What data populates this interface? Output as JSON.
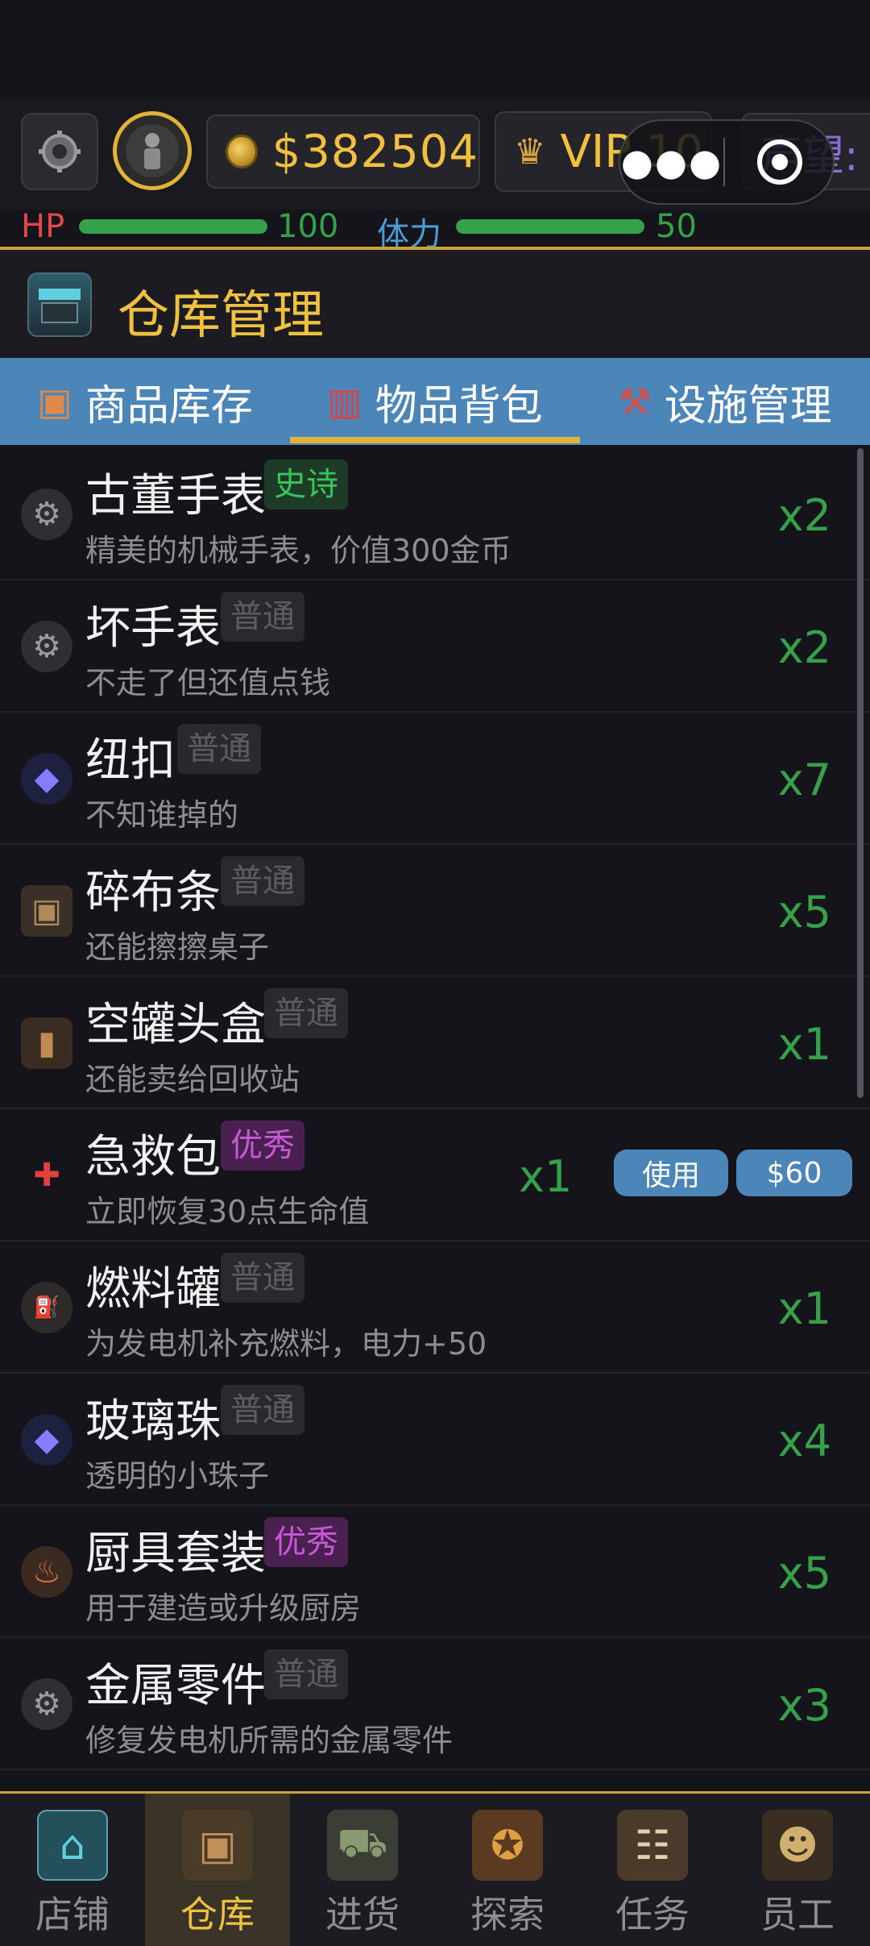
{
  "colors": {
    "accent_gold": "#f0c040",
    "tab_blue": "#4c86b8",
    "qty_green": "#35a14a",
    "hp_red": "#e04848",
    "stamina_blue": "#4c9ad6",
    "rep_purple": "#8b6fd6"
  },
  "top": {
    "money": "$382504",
    "vip": "VIP 10",
    "reputation": "声望:"
  },
  "stats": {
    "hp_label": "HP",
    "hp_value": "100",
    "hp_fill": 1.0,
    "stamina_label": "体力",
    "stamina_value": "50",
    "stamina_fill": 1.0
  },
  "header": {
    "title": "仓库管理",
    "icon": "shop-sign-icon"
  },
  "tabs": [
    {
      "label": "商品库存",
      "icon": "box-icon"
    },
    {
      "label": "物品背包",
      "icon": "backpack-icon"
    },
    {
      "label": "设施管理",
      "icon": "crane-icon"
    }
  ],
  "items": [
    {
      "name": "古董手表",
      "tag": "史诗",
      "desc": "精美的机械手表，价值300金币",
      "qty": "x2",
      "icon": "gear-icon"
    },
    {
      "name": "坏手表",
      "tag": "普通",
      "desc": "不走了但还值点钱",
      "qty": "x2",
      "icon": "gear-icon"
    },
    {
      "name": "纽扣",
      "tag": "普通",
      "desc": "不知谁掉的",
      "qty": "x7",
      "icon": "gem-icon"
    },
    {
      "name": "碎布条",
      "tag": "普通",
      "desc": "还能擦擦桌子",
      "qty": "x5",
      "icon": "crate-icon"
    },
    {
      "name": "空罐头盒",
      "tag": "普通",
      "desc": "还能卖给回收站",
      "qty": "x1",
      "icon": "can-icon"
    },
    {
      "name": "急救包",
      "tag": "优秀",
      "desc": "立即恢复30点生命值",
      "qty": "x1",
      "icon": "medkit-icon",
      "use_label": "使用",
      "sell_label": "$60"
    },
    {
      "name": "燃料罐",
      "tag": "普通",
      "desc": "为发电机补充燃料，电力+50",
      "qty": "x1",
      "icon": "fuel-icon"
    },
    {
      "name": "玻璃珠",
      "tag": "普通",
      "desc": "透明的小珠子",
      "qty": "x4",
      "icon": "gem-icon"
    },
    {
      "name": "厨具套装",
      "tag": "优秀",
      "desc": "用于建造或升级厨房",
      "qty": "x5",
      "icon": "stove-icon"
    },
    {
      "name": "金属零件",
      "tag": "普通",
      "desc": "修复发电机所需的金属零件",
      "qty": "x3",
      "icon": "gear-icon"
    }
  ],
  "nav": [
    {
      "label": "店铺",
      "icon": "shop-icon"
    },
    {
      "label": "仓库",
      "icon": "warehouse-icon"
    },
    {
      "label": "进货",
      "icon": "truck-icon"
    },
    {
      "label": "探索",
      "icon": "map-icon"
    },
    {
      "label": "任务",
      "icon": "clipboard-icon"
    },
    {
      "label": "员工",
      "icon": "team-icon"
    }
  ]
}
